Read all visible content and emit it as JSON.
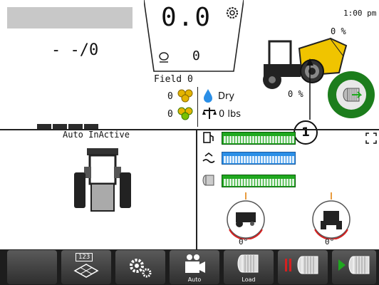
{
  "clock": "1:00 pm",
  "top_left": {
    "counter": "- -/0"
  },
  "speed": {
    "value": "0.0",
    "secondary": "0"
  },
  "field": {
    "label": "Field 0",
    "bales_count": "0",
    "moisture": "Dry",
    "wrapped_count": "0",
    "weight": "0 lbs"
  },
  "machine": {
    "pct_top": "0 %",
    "pct_mid": "0 %"
  },
  "callout": "1",
  "auto_panel": {
    "status": "Auto InActive"
  },
  "gauges": {
    "left_angle": "0°",
    "right_angle": "0°"
  },
  "levels": {
    "fuel": 1.0,
    "water": 1.0,
    "wrap": 1.0
  },
  "toolbar": {
    "auto_label": "Auto",
    "load_label": "Load",
    "field_icon_text": "123"
  },
  "colors": {
    "green": "#1fa81f",
    "blue": "#2a8ee6",
    "dark_green": "#1c7d1c",
    "yellow": "#f0c400",
    "red": "#d42020"
  }
}
